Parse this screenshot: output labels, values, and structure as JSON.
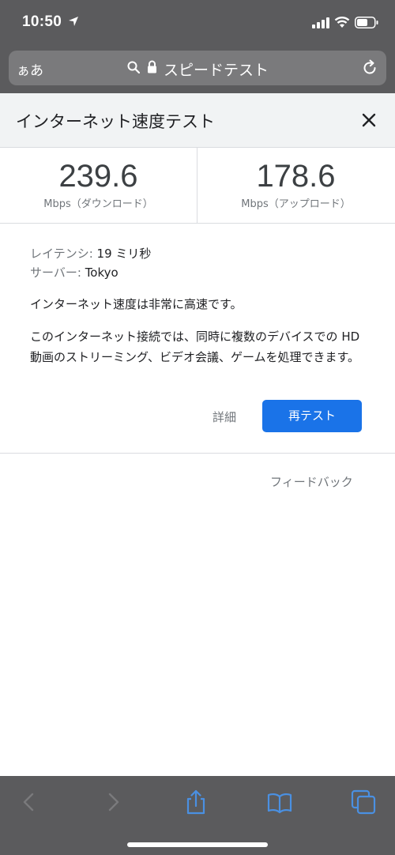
{
  "status_bar": {
    "time": "10:50"
  },
  "address_bar": {
    "aa_label": "ぁあ",
    "url_text": "スピードテスト"
  },
  "widget": {
    "title": "インターネット速度テスト",
    "download": {
      "value": "239.6",
      "unit": "Mbps（ダウンロード）"
    },
    "upload": {
      "value": "178.6",
      "unit": "Mbps（アップロード）"
    },
    "latency": {
      "label": "レイテンシ:",
      "value": "19 ミリ秒"
    },
    "server": {
      "label": "サーバー:",
      "value": "Tokyo"
    },
    "summary": "インターネット速度は非常に高速です。",
    "description": "このインターネット接続では、同時に複数のデバイスでの HD 動画のストリーミング、ビデオ会議、ゲームを処理できます。",
    "details_label": "詳細",
    "retest_label": "再テスト",
    "feedback_label": "フィードバック"
  },
  "colors": {
    "accent": "#1a73e8",
    "chrome": "#5b5b5d",
    "toolbar_icon": "#4a90e2"
  },
  "toolbar_icons": [
    "back-icon",
    "forward-icon",
    "share-icon",
    "bookmarks-icon",
    "tabs-icon"
  ]
}
